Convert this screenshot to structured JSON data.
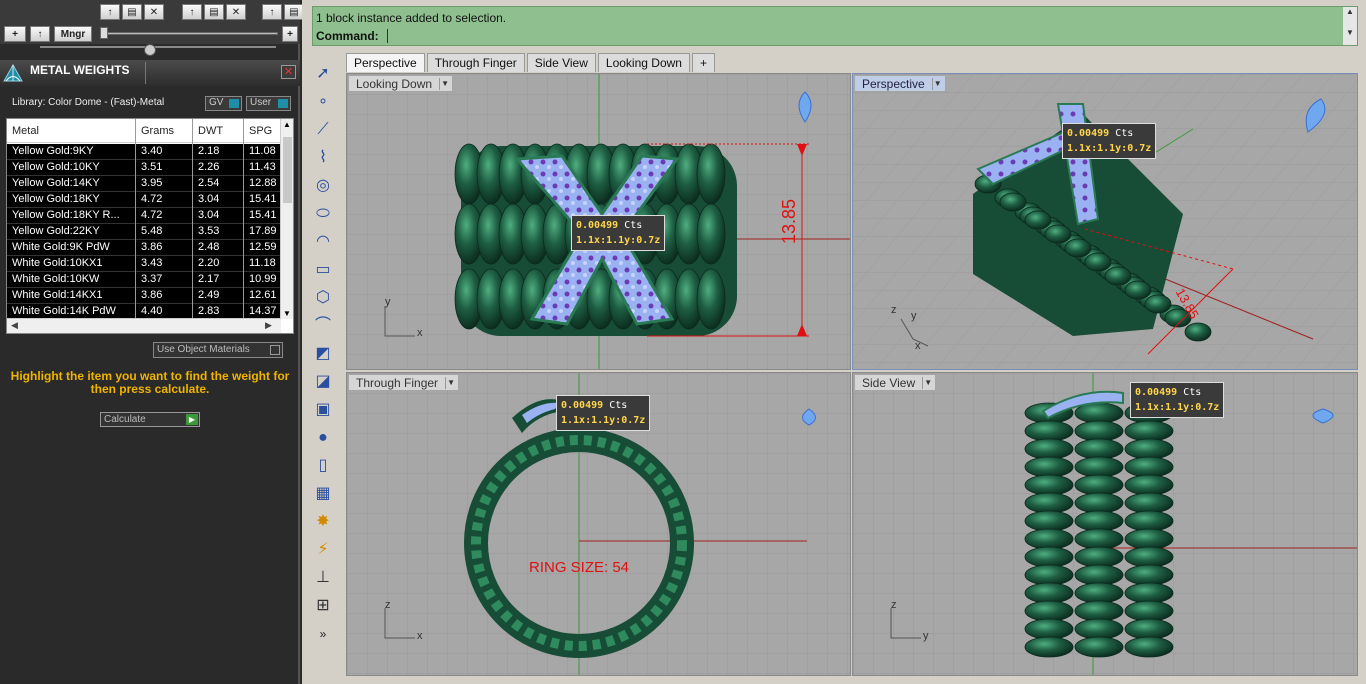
{
  "left_panel": {
    "toolbar2": {
      "add": "+",
      "up": "↑",
      "mngr": "Mngr",
      "add2": "+"
    },
    "title": "METAL WEIGHTS",
    "library_label": "Library: Color Dome - (Fast)-Metal",
    "gv_label": "GV",
    "user_label": "User",
    "table": {
      "columns": [
        "Metal",
        "Grams",
        "DWT",
        "SPG"
      ],
      "rows": [
        [
          "Yellow Gold:9KY",
          "3.40",
          "2.18",
          "11.08"
        ],
        [
          "Yellow Gold:10KY",
          "3.51",
          "2.26",
          "11.43"
        ],
        [
          "Yellow Gold:14KY",
          "3.95",
          "2.54",
          "12.88"
        ],
        [
          "Yellow Gold:18KY",
          "4.72",
          "3.04",
          "15.41"
        ],
        [
          "Yellow Gold:18KY R...",
          "4.72",
          "3.04",
          "15.41"
        ],
        [
          "Yellow Gold:22KY",
          "5.48",
          "3.53",
          "17.89"
        ],
        [
          "White Gold:9K PdW",
          "3.86",
          "2.48",
          "12.59"
        ],
        [
          "White Gold:10KX1",
          "3.43",
          "2.20",
          "11.18"
        ],
        [
          "White Gold:10KW",
          "3.37",
          "2.17",
          "10.99"
        ],
        [
          "White Gold:14KX1",
          "3.86",
          "2.49",
          "12.61"
        ],
        [
          "White Gold:14K PdW",
          "4.40",
          "2.83",
          "14.37"
        ]
      ]
    },
    "use_object_materials": "Use Object Materials",
    "hint": "Highlight the item you want to find the weight for then press calculate.",
    "calculate": "Calculate"
  },
  "command": {
    "history": "1 block instance added to selection.",
    "prompt": "Command:"
  },
  "tabs": [
    "Perspective",
    "Through Finger",
    "Side View",
    "Looking Down",
    "+"
  ],
  "viewports": {
    "looking_down": {
      "label": "Looking Down",
      "dimension": "13.85"
    },
    "perspective": {
      "label": "Perspective",
      "dimension": "13.85"
    },
    "through_finger": {
      "label": "Through Finger",
      "ring_size": "RING SIZE: 54"
    },
    "side_view": {
      "label": "Side View"
    }
  },
  "tooltip": {
    "carat_value": "0.00499",
    "carat_unit": "Cts",
    "scale_line": "1.1x:1.1y:0.7z"
  },
  "axes": {
    "x": "x",
    "y": "y",
    "z": "z"
  },
  "colors": {
    "ring": "#1e5e43",
    "ring_light": "#3a9a6a",
    "stones": "#8fa8ef",
    "accent": "#1e8fa8",
    "dimension": "#e01010"
  }
}
